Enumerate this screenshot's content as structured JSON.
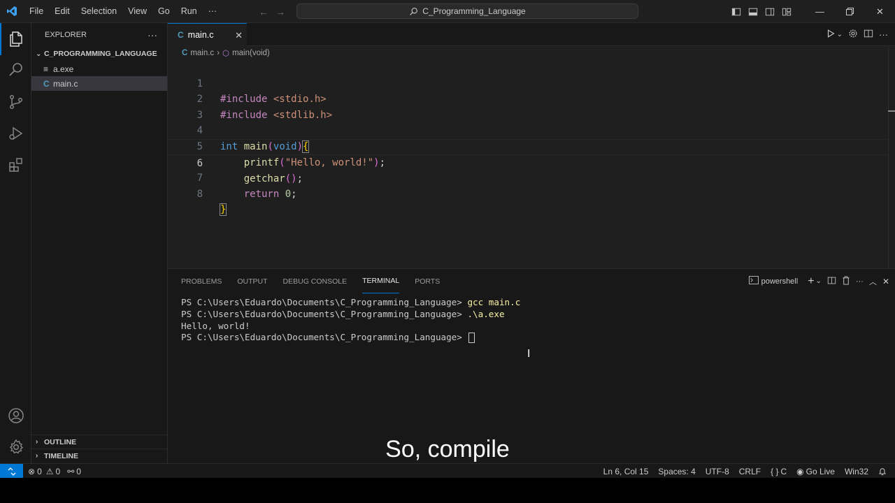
{
  "titlebar": {
    "menu": [
      "File",
      "Edit",
      "Selection",
      "View",
      "Go",
      "Run",
      "···"
    ],
    "search_text": "C_Programming_Language"
  },
  "sidebar": {
    "title": "EXPLORER",
    "more": "···",
    "folder": "C_PROGRAMMING_LANGUAGE",
    "files": [
      {
        "name": "a.exe",
        "icon": "≡"
      },
      {
        "name": "main.c",
        "icon": "C"
      }
    ],
    "outline": "OUTLINE",
    "timeline": "TIMELINE"
  },
  "editor": {
    "tab_label": "main.c",
    "tab_icon": "C",
    "breadcrumb_file": "main.c",
    "breadcrumb_symbol": "main(void)",
    "line_numbers": [
      "1",
      "2",
      "3",
      "4",
      "5",
      "6",
      "7",
      "8"
    ],
    "code": {
      "l1_pp": "#include",
      "l1_hdr": "<stdio.h>",
      "l2_pp": "#include",
      "l2_hdr": "<stdlib.h>",
      "l4_type": "int",
      "l4_fn": "main",
      "l4_param": "void",
      "l5_fn": "printf",
      "l5_str": "\"Hello, world!\"",
      "l6_fn": "getchar",
      "l7_kw": "return",
      "l7_num": "0"
    }
  },
  "panel": {
    "tabs": [
      "PROBLEMS",
      "OUTPUT",
      "DEBUG CONSOLE",
      "TERMINAL",
      "PORTS"
    ],
    "active_tab": "TERMINAL",
    "shell": "powershell",
    "prompt": "PS C:\\Users\\Eduardo\\Documents\\C_Programming_Language>",
    "cmd1": "gcc main.c",
    "cmd2": ".\\a.exe",
    "output": "Hello, world!"
  },
  "caption": "So, compile",
  "statusbar": {
    "errors": "0",
    "warnings": "0",
    "ports": "0",
    "position": "Ln 6, Col 15",
    "spaces": "Spaces: 4",
    "encoding": "UTF-8",
    "eol": "CRLF",
    "language": "C",
    "golive": "Go Live",
    "platform": "Win32"
  },
  "colors": {
    "accent": "#0078d4",
    "c_icon": "#519aba"
  }
}
